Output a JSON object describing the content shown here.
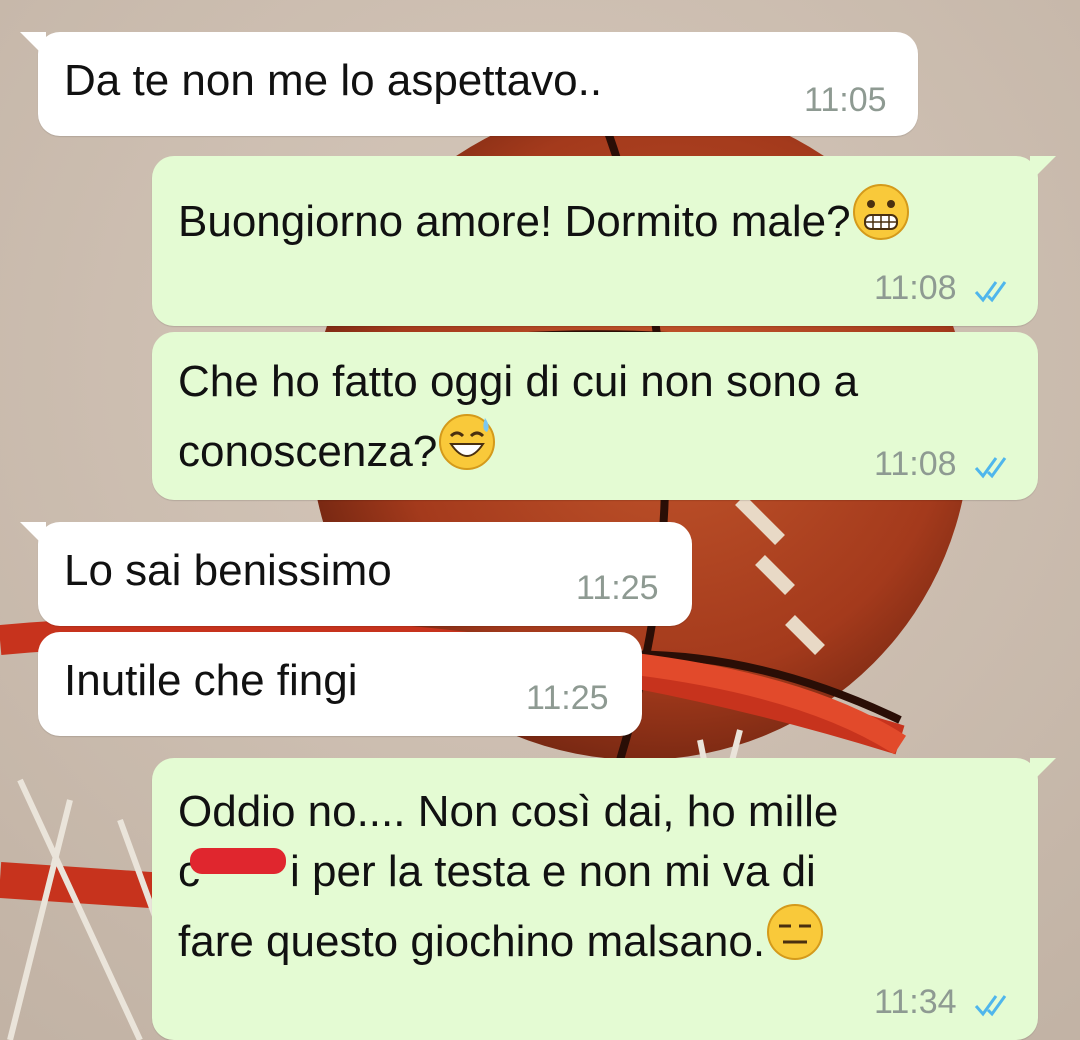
{
  "colors": {
    "incoming_bubble": "#ffffff",
    "outgoing_bubble": "#e4fbd3",
    "read_ticks": "#4fb6ec",
    "timestamp": "#8e9a92",
    "redaction": "#e0262e"
  },
  "messages": [
    {
      "direction": "incoming",
      "text": "Da te non me lo aspettavo..",
      "time": "11:05"
    },
    {
      "direction": "outgoing",
      "text": "Buongiorno amore! Dormito male?",
      "emoji": "grimacing-face",
      "time": "11:08",
      "status": "read"
    },
    {
      "direction": "outgoing",
      "line1": "Che ho fatto oggi di cui non sono a",
      "line2": "conoscenza?",
      "emoji": "grinning-sweat-face",
      "time": "11:08",
      "status": "read"
    },
    {
      "direction": "incoming",
      "text": "Lo sai benissimo",
      "time": "11:25"
    },
    {
      "direction": "incoming",
      "text": "Inutile che fingi",
      "time": "11:25"
    },
    {
      "direction": "outgoing",
      "line1": "Oddio no.... Non così dai, ho mille",
      "line2_start": "c",
      "line2_end": "i per la testa e non mi va di",
      "line3": "fare questo giochino malsano.",
      "emoji": "expressionless-face",
      "time": "11:34",
      "status": "read"
    }
  ]
}
